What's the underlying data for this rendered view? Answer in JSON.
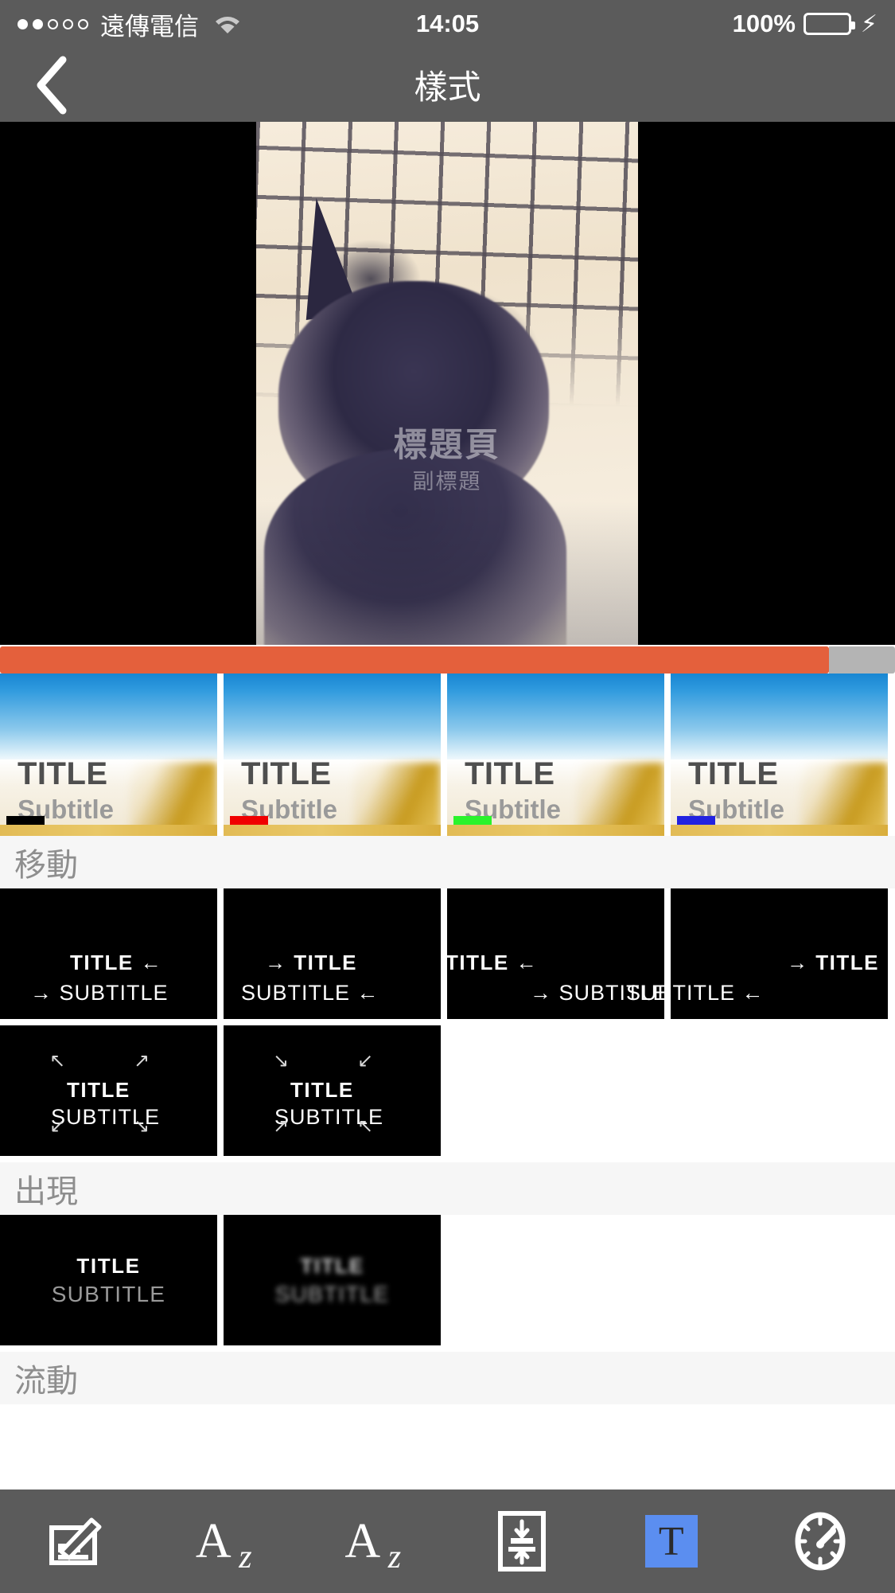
{
  "status_bar": {
    "signal_dots_filled": 2,
    "signal_dots_total": 5,
    "carrier": "遠傳電信",
    "wifi_icon": "wifi-icon",
    "time": "14:05",
    "battery_percent": "100%",
    "battery_color": "#4cd964",
    "charging_icon": "bolt-icon"
  },
  "navbar": {
    "back_icon": "chevron-left-icon",
    "title": "樣式"
  },
  "preview": {
    "overlay_title": "標題頁",
    "overlay_subtitle": "副標題",
    "background_color": "#000000"
  },
  "scrubber": {
    "fill_color": "#e4603c",
    "track_color": "#b4b4b4",
    "progress_percent": 92
  },
  "style_cards": [
    {
      "title": "TITLE",
      "subtitle": "Subtitle",
      "accent_color": "#000000",
      "accent_name": "black"
    },
    {
      "title": "TITLE",
      "subtitle": "Subtitle",
      "accent_color": "#f00000",
      "accent_name": "red"
    },
    {
      "title": "TITLE",
      "subtitle": "Subtitle",
      "accent_color": "#2bf32b",
      "accent_name": "green"
    },
    {
      "title": "TITLE",
      "subtitle": "Subtitle",
      "accent_color": "#2222e0",
      "accent_name": "blue"
    }
  ],
  "sections": [
    {
      "heading": "移動",
      "cards": [
        {
          "title": "TITLE",
          "title_arrow": "←",
          "title_arrow_side": "right",
          "subtitle": "SUBTITLE",
          "subtitle_arrow": "→",
          "subtitle_arrow_side": "left"
        },
        {
          "title": "TITLE",
          "title_arrow": "→",
          "title_arrow_side": "left",
          "subtitle": "SUBTITLE",
          "subtitle_arrow": "←",
          "subtitle_arrow_side": "right"
        },
        {
          "title": "TITLE",
          "title_arrow": "←",
          "title_arrow_side": "right",
          "subtitle": "SUBTITLE",
          "subtitle_arrow": "→",
          "subtitle_arrow_side": "left"
        },
        {
          "title": "TITLE",
          "title_arrow": "→",
          "title_arrow_side": "left",
          "subtitle": "SUBTITLE",
          "subtitle_arrow": "←",
          "subtitle_arrow_side": "right"
        },
        {
          "title": "TITLE",
          "subtitle": "SUBTITLE",
          "corner_arrows": "outward",
          "corners": [
            "↖",
            "↗",
            "↙",
            "↘"
          ]
        },
        {
          "title": "TITLE",
          "subtitle": "SUBTITLE",
          "corner_arrows": "inward",
          "corners": [
            "↘",
            "↙",
            "↗",
            "↖"
          ]
        }
      ]
    },
    {
      "heading": "出現",
      "cards": [
        {
          "title": "TITLE",
          "subtitle": "SUBTITLE",
          "effect": "fade"
        },
        {
          "title": "TITLE",
          "subtitle": "SUBTITLE",
          "effect": "blur"
        }
      ]
    },
    {
      "heading": "流動",
      "cards": []
    }
  ],
  "toolbar": {
    "items": [
      {
        "icon": "edit-signature-icon",
        "label": "",
        "active": false
      },
      {
        "icon": "font-az-icon",
        "label": "Az",
        "active": false
      },
      {
        "icon": "font-size-az-icon",
        "label": "Az",
        "active": false
      },
      {
        "icon": "line-spacing-icon",
        "label": "",
        "active": false
      },
      {
        "icon": "text-style-t-icon",
        "label": "T",
        "active": true,
        "active_color": "#5b8ef0"
      },
      {
        "icon": "speed-gauge-icon",
        "label": "",
        "active": false
      }
    ]
  }
}
